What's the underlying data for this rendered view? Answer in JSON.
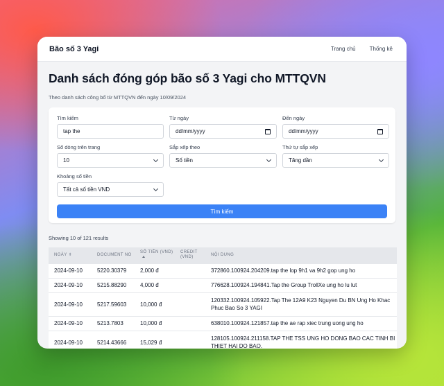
{
  "nav": {
    "brand": "Bão số 3 Yagi",
    "links": [
      "Trang chủ",
      "Thống kê"
    ]
  },
  "page": {
    "title": "Danh sách đóng góp bão số 3 Yagi cho MTTQVN",
    "subtitle": "Theo danh sách công bố từ MTTQVN đến ngày 10/09/2024"
  },
  "filters": {
    "search_label": "Tìm kiếm",
    "search_value": "tap the",
    "from_label": "Từ ngày",
    "from_value": "dd/mm/yyyy",
    "to_label": "Đến ngày",
    "to_value": "dd/mm/yyyy",
    "rows_label": "Số dòng trên trang",
    "rows_value": "10",
    "sort_label": "Sắp xếp theo",
    "sort_value": "Số tiền",
    "order_label": "Thứ tự sắp xếp",
    "order_value": "Tăng dần",
    "range_label": "Khoảng số tiền",
    "range_value": "Tất cả số tiền VND",
    "submit_label": "Tìm kiếm"
  },
  "results": {
    "summary": "Showing 10 of 121 results"
  },
  "table": {
    "columns": [
      "NGÀY",
      "DOCUMENT NO",
      "SỐ TIỀN (VND)",
      "CREDIT (VND)",
      "NỘI DUNG"
    ],
    "rows": [
      [
        "2024-09-10",
        "5220.30379",
        "2,000 đ",
        "",
        "372860.100924.204209.tap the lop 9h1 va 9h2 gop ung ho"
      ],
      [
        "2024-09-10",
        "5215.88290",
        "4,000 đ",
        "",
        "776628.100924.194841.Tap the Group TrollXe ung ho lu lut"
      ],
      [
        "2024-09-10",
        "5217.59603",
        "10,000 đ",
        "",
        "120332.100924.105922.Tap The 12A9 K23 Nguyen Du BN Ung Ho Khac Phuc Bao So 3 YAGI"
      ],
      [
        "2024-09-10",
        "5213.7803",
        "10,000 đ",
        "",
        "638010.100924.121857.tap the ae rap xiec trung uong ung ho"
      ],
      [
        "2024-09-10",
        "5214.43666",
        "15,029 đ",
        "",
        "128105.100924.211158.TAP THE TSS UNG HO DONG BAO CAC TINH BI THIET HAI DO BAO."
      ]
    ]
  }
}
